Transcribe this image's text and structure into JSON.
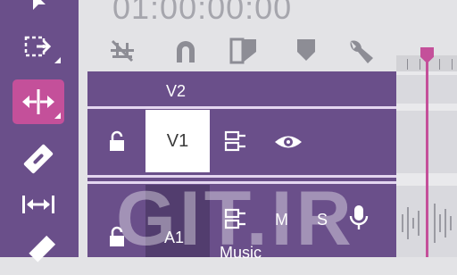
{
  "timecode": "01:00:00:00",
  "tools": [
    {
      "name": "selection-tool"
    },
    {
      "name": "track-select-tool"
    },
    {
      "name": "ripple-edit-tool",
      "active": true
    },
    {
      "name": "razor-tool"
    },
    {
      "name": "slip-tool"
    },
    {
      "name": "pen-tool"
    }
  ],
  "toolbar_icons": [
    "snap-icon",
    "linked-selection-icon",
    "add-marker-icon",
    "marker-icon",
    "settings-wrench-icon"
  ],
  "tracks": {
    "v2": {
      "label": "V2"
    },
    "v1": {
      "label": "V1",
      "target_label": "V1"
    },
    "a1": {
      "label": "A1",
      "mute": "M",
      "solo": "S",
      "name": "Music"
    }
  },
  "watermark": "GIT.IR",
  "colors": {
    "panel": "#6a4f8a",
    "accent": "#c4509a",
    "separator": "#e4d6f0",
    "background": "#e3e3e6"
  }
}
